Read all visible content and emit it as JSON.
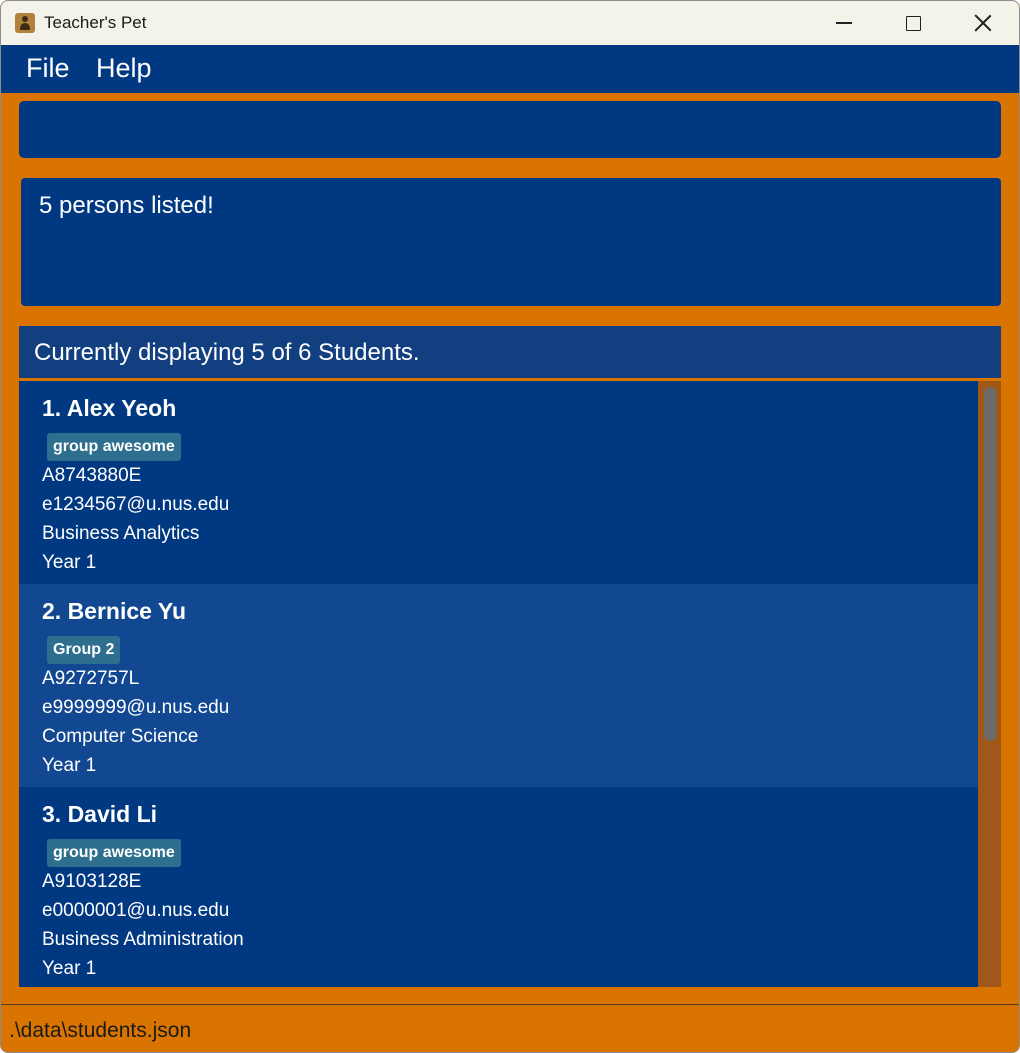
{
  "window": {
    "title": "Teacher's Pet"
  },
  "menu": {
    "file": "File",
    "help": "Help"
  },
  "command": {
    "value": ""
  },
  "result": {
    "message": "5 persons listed!"
  },
  "list": {
    "header": "Currently displaying 5 of 6 Students.",
    "students": [
      {
        "name": "1. Alex Yeoh",
        "tag": "group awesome",
        "id": "A8743880E",
        "email": "e1234567@u.nus.edu",
        "major": "Business Analytics",
        "year": "Year 1"
      },
      {
        "name": "2. Bernice Yu",
        "tag": "Group 2",
        "id": "A9272757L",
        "email": "e9999999@u.nus.edu",
        "major": "Computer Science",
        "year": "Year 1"
      },
      {
        "name": "3. David Li",
        "tag": "group awesome",
        "id": "A9103128E",
        "email": "e0000001@u.nus.edu",
        "major": "Business Administration",
        "year": "Year 1"
      }
    ]
  },
  "status": {
    "path": ".\\data\\students.json"
  },
  "colors": {
    "accent_orange": "#d97400",
    "panel_blue": "#013882",
    "alt_row_blue": "#124891",
    "tag": "#2e6f8f"
  }
}
